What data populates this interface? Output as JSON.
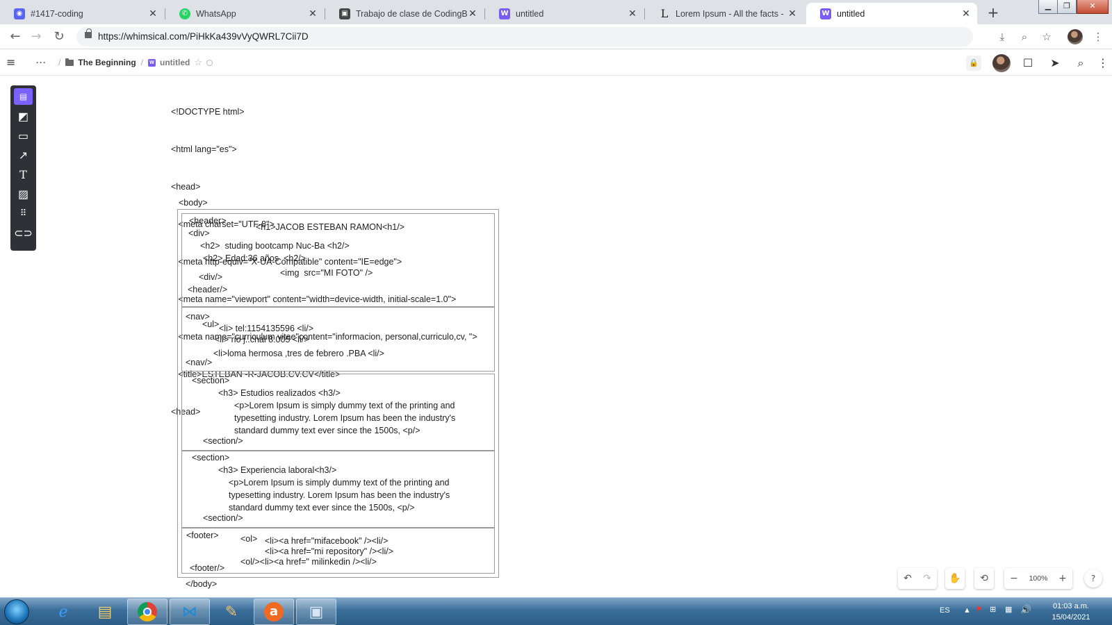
{
  "browser": {
    "tabs": [
      {
        "title": "#1417-coding",
        "icon": "discord-icon",
        "color": "#5865f2"
      },
      {
        "title": "WhatsApp",
        "icon": "whatsapp-icon",
        "color": "#25d366"
      },
      {
        "title": "Trabajo de clase de CodingBoot",
        "icon": "classroom-icon",
        "color": "#444444"
      },
      {
        "title": "untitled",
        "icon": "whimsical-icon",
        "color": "#7a5cf0"
      },
      {
        "title": "Lorem Ipsum - All the facts - Lip",
        "icon": "lipsum-icon",
        "color": "#222222"
      },
      {
        "title": "untitled",
        "icon": "whimsical-icon",
        "color": "#7a5cf0",
        "active": true
      }
    ],
    "url": "https://whimsical.com/PiHkKa439vVyQWRL7Cii7D"
  },
  "whimsical": {
    "breadcrumb": {
      "more": "···",
      "folder": "The Beginning",
      "doc": "untitled"
    }
  },
  "canvas": {
    "head_lines": [
      "<!DOCTYPE html>",
      "<html lang=\"es\">",
      "<head>",
      "   <meta charset=\"UTF-8\">",
      "   <meta http-equiv=\"X-UA-Compatible\" content=\"IE=edge\">",
      "   <meta name=\"viewport\" content=\"width=device-width, initial-scale=1.0\">",
      "   <meta name=\"curriculum vitae\"content=\"informacion, personal,curriculo,cv, \">",
      "   <title>ESTEBAN -R-JACOB.CV.CV</title>",
      "<head>"
    ],
    "body_open": "<body>",
    "body_close": "</body>",
    "header_block": {
      "header": "<header>",
      "h1": "<h1>JACOB ESTEBAN RAMON<h1/>",
      "div": "<div>",
      "h2a": "<h2>  studing bootcamp Nuc-Ba <h2/>",
      "h2b": "<h2> Edad:36 años  <h2/>",
      "img": "<img  src=\"MI FOTO\" />",
      "div_close": "<div/>",
      "header_close": "<header/>"
    },
    "nav_block": {
      "nav": "<nav>",
      "ul": "<ul>",
      "li1": "<li> tel:1154135596 <li/>",
      "li2": "<li> rio j..chal 8.005 <li/>",
      "li3": "<li>loma hermosa ,tres de febrero .PBA <li/>",
      "nav_close": "<nav/>"
    },
    "section1": {
      "open": "<section>",
      "h3": "<h3> Estudios realizados <h3/>",
      "p1": "<p>Lorem Ipsum is simply dummy text of the printing and",
      "p2": "typesetting industry. Lorem Ipsum has been the industry's",
      "p3": "standard dummy text ever since the 1500s, <p/>",
      "close": "<section/>"
    },
    "section2": {
      "open": "<section>",
      "h3": "<h3> Experiencia laboral<h3/>",
      "p1": "<p>Lorem Ipsum is simply dummy text of the printing and",
      "p2": "typesetting industry. Lorem Ipsum has been the industry's",
      "p3": "standard dummy text ever since the 1500s, <p/>",
      "close": "<section/>"
    },
    "footer_block": {
      "footer": "<footer>",
      "ol": "<ol>",
      "li1": "<li><a href=\"mifacebook\" /><li/>",
      "li2": "<li><a href=\"mi repository\" /><li/>",
      "li3": "<ol/><li><a href=\" milinkedin /><li/>",
      "footer_close": "<footer/>"
    }
  },
  "controls": {
    "zoom": "100%",
    "help": "?"
  },
  "taskbar": {
    "language": "ES",
    "time": "01:03 a.m.",
    "date": "15/04/2021"
  }
}
